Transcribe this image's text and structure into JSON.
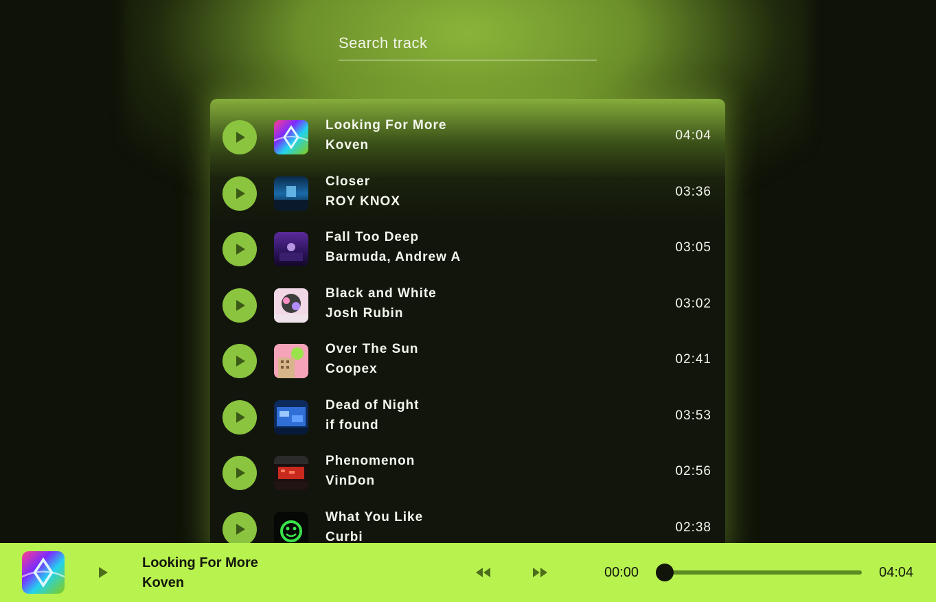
{
  "search": {
    "placeholder": "Search track"
  },
  "colors": {
    "accent": "#8bc43f",
    "player_bg": "#b8f24f",
    "background": "#0f1208",
    "panel": "#12150c"
  },
  "tracks": [
    {
      "title": "Looking For More",
      "artist": "Koven",
      "duration": "04:04",
      "cover_icon": "album-cover-looking-for-more"
    },
    {
      "title": "Closer",
      "artist": "ROY KNOX",
      "duration": "03:36",
      "cover_icon": "album-cover-closer"
    },
    {
      "title": "Fall Too Deep",
      "artist": "Barmuda, Andrew A",
      "duration": "03:05",
      "cover_icon": "album-cover-fall-too-deep"
    },
    {
      "title": "Black and White",
      "artist": "Josh Rubin",
      "duration": "03:02",
      "cover_icon": "album-cover-black-and-white"
    },
    {
      "title": "Over The Sun",
      "artist": "Coopex",
      "duration": "02:41",
      "cover_icon": "album-cover-over-the-sun"
    },
    {
      "title": "Dead of Night",
      "artist": "if found",
      "duration": "03:53",
      "cover_icon": "album-cover-dead-of-night"
    },
    {
      "title": "Phenomenon",
      "artist": "VinDon",
      "duration": "02:56",
      "cover_icon": "album-cover-phenomenon"
    },
    {
      "title": "What You Like",
      "artist": "Curbi",
      "duration": "02:38",
      "cover_icon": "album-cover-what-you-like"
    }
  ],
  "player": {
    "title": "Looking For More",
    "artist": "Koven",
    "current_time": "00:00",
    "total_time": "04:04",
    "progress": 0,
    "icons": {
      "play": "play-icon",
      "rewind": "rewind-icon",
      "forward": "fast-forward-icon"
    }
  }
}
